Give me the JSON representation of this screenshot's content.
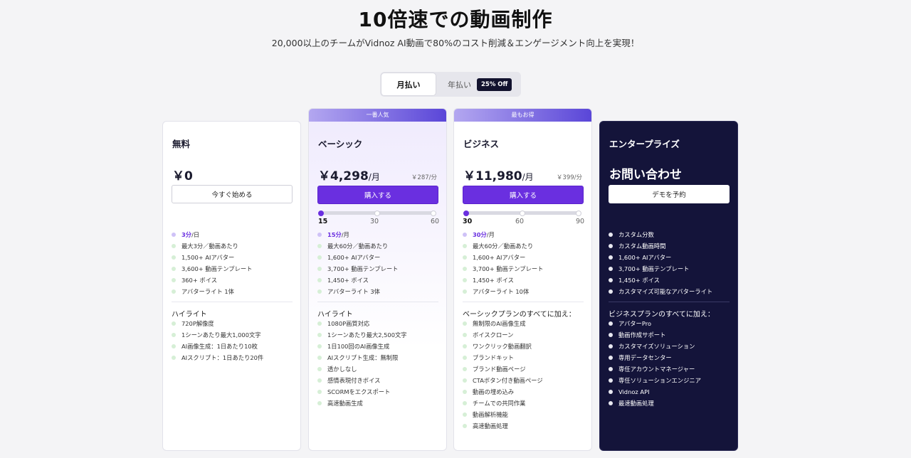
{
  "hero": {
    "title": "10倍速での動画制作",
    "subtitle": "20,000以上のチームがVidnoz AI動画で80%のコスト削減＆エンゲージメント向上を実現！"
  },
  "billing": {
    "monthly": "月払い",
    "yearly": "年払い",
    "badge": "25% Off"
  },
  "plans": {
    "free": {
      "name": "無料",
      "price": "￥0",
      "button": "今すぐ始める",
      "features_top": [
        {
          "hl": "3分",
          "text": "/日"
        },
        {
          "hl": "",
          "text": "最大3分／動画あたり"
        },
        {
          "hl": "",
          "text": "1,500+ AIアバター"
        },
        {
          "hl": "",
          "text": "3,600+ 動画テンプレート"
        },
        {
          "hl": "",
          "text": "360+ ボイス"
        },
        {
          "hl": "",
          "text": "アバターライト 1体"
        }
      ],
      "section_title": "ハイライト",
      "features_bottom": [
        "720P解像度",
        "1シーンあたり最大1,000文字",
        "AI画像生成：1日あたり10枚",
        "AIスクリプト：1日あたり20件"
      ]
    },
    "basic": {
      "ribbon": "一番人気",
      "name": "ベーシック",
      "price": "￥4,298",
      "price_unit": "/月",
      "per_min": "￥287/分",
      "button": "購入する",
      "slider": {
        "ticks": [
          "15",
          "30",
          "60"
        ],
        "active": 0
      },
      "features_top": [
        {
          "hl": "15分",
          "text": "/月"
        },
        {
          "hl": "",
          "text": "最大60分／動画あたり"
        },
        {
          "hl": "",
          "text": "1,600+ AIアバター"
        },
        {
          "hl": "",
          "text": "3,700+ 動画テンプレート"
        },
        {
          "hl": "",
          "text": "1,450+ ボイス"
        },
        {
          "hl": "",
          "text": "アバターライト 3体"
        }
      ],
      "section_title": "ハイライト",
      "features_bottom": [
        "1080P画質対応",
        "1シーンあたり最大2,500文字",
        "1日100回のAI画像生成",
        "AIスクリプト生成：無制限",
        "透かしなし",
        "感情表現付きボイス",
        "SCORMをエクスポート",
        "高速動画生成"
      ]
    },
    "business": {
      "ribbon": "最もお得",
      "name": "ビジネス",
      "price": "￥11,980",
      "price_unit": "/月",
      "per_min": "￥399/分",
      "button": "購入する",
      "slider": {
        "ticks": [
          "30",
          "60",
          "90"
        ],
        "active": 0
      },
      "features_top": [
        {
          "hl": "30分",
          "text": "/月"
        },
        {
          "hl": "",
          "text": "最大60分／動画あたり"
        },
        {
          "hl": "",
          "text": "1,600+ AIアバター"
        },
        {
          "hl": "",
          "text": "3,700+ 動画テンプレート"
        },
        {
          "hl": "",
          "text": "1,450+ ボイス"
        },
        {
          "hl": "",
          "text": "アバターライト 10体"
        }
      ],
      "section_title": "ベーシックプランのすべてに加え：",
      "features_bottom": [
        "無制限のAI画像生成",
        "ボイスクローン",
        "ワンクリック動画翻訳",
        "ブランドキット",
        "ブランド動画ページ",
        "CTAボタン付き動画ページ",
        "動画の埋め込み",
        "チームでの共同作業",
        "動画解析機能",
        "高速動画処理"
      ]
    },
    "enterprise": {
      "name": "エンタープライズ",
      "contact": "お問い合わせ",
      "button": "デモを予約",
      "features_top": [
        "カスタム分数",
        "カスタム動画時間",
        "1,600+ AIアバター",
        "3,700+ 動画テンプレート",
        "1,450+ ボイス",
        "カスタマイズ可能なアバターライト"
      ],
      "section_title": "ビジネスプランのすべてに加え：",
      "features_bottom": [
        "アバターPro",
        "動画作成サポート",
        "カスタマイズソリューション",
        "専用データセンター",
        "専任アカウントマネージャー",
        "専任ソリューションエンジニア",
        "Vidnoz API",
        "最速動画処理"
      ]
    }
  }
}
